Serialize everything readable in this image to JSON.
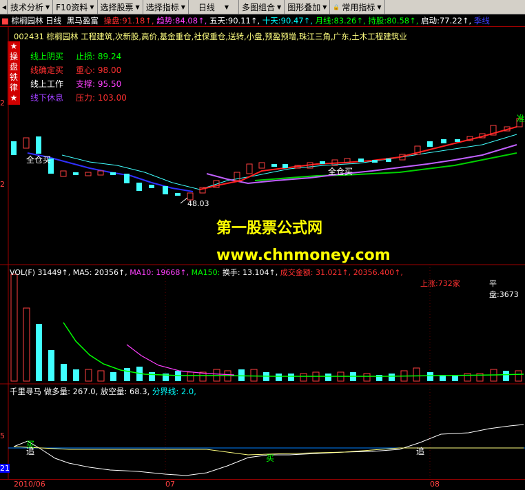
{
  "toolbar": {
    "items": [
      {
        "label": "技术分析"
      },
      {
        "label": "F10资料"
      },
      {
        "label": "选择股票"
      },
      {
        "label": "选择指标"
      },
      {
        "label": "日线"
      },
      {
        "label": "多图组合"
      },
      {
        "label": "图形叠加"
      },
      {
        "label": "常用指标"
      }
    ]
  },
  "header": {
    "title": "棕榈园林 日线",
    "sub": "黑马盈富",
    "stats": [
      {
        "label": "操盘:",
        "value": "91.18",
        "color": "#ff3030"
      },
      {
        "label": "趋势:",
        "value": "84.08",
        "color": "#ff40ff"
      },
      {
        "label": "五天:",
        "value": "90.11",
        "color": "#ffffff"
      },
      {
        "label": "十天:",
        "value": "90.47",
        "color": "#00ffff"
      },
      {
        "label": "月线:",
        "value": "83.26",
        "color": "#00ff00"
      },
      {
        "label": "持股:",
        "value": "80.58",
        "color": "#00ff00"
      },
      {
        "label": "启动:",
        "value": "77.22",
        "color": "#ffffff"
      },
      {
        "label": "季线",
        "value": "",
        "color": "#4040ff"
      }
    ],
    "info": "002431 棕榈园林 工程建筑,次新股,高价,基金重仓,社保重仓,送转,小盘,预盈预增,珠江三角,广东,土木工程建筑业"
  },
  "badge": {
    "chars": [
      "★",
      "操",
      "盘",
      "铁",
      "律",
      "★"
    ]
  },
  "legend": [
    {
      "name": "线上阴买",
      "label": "止损:",
      "value": "89.24",
      "color": "#00ff00"
    },
    {
      "name": "线确定买",
      "label": "重心:",
      "value": "98.00",
      "color": "#ff3030"
    },
    {
      "name": "线上工作",
      "label": "支撑:",
      "value": "95.50",
      "color": "#ffffff"
    },
    {
      "name": "线下休息",
      "label": "压力:",
      "value": "103.00",
      "color": "#a040ff"
    }
  ],
  "price_annotations": {
    "low_label": "48.03",
    "buy1": "全仓买",
    "buy2": "全仓买",
    "sell": "准"
  },
  "watermark": {
    "line1": "第一股票公式网",
    "line2": "www.chnmoney.com"
  },
  "vol": {
    "header": [
      {
        "text": "VOL(F) 31449",
        "color": "#ffffff"
      },
      {
        "text": "MA5: 20356",
        "color": "#ffffff"
      },
      {
        "text": "MA10: 19668",
        "color": "#ff40ff"
      },
      {
        "text": "MA150: ",
        "color": "#00ff00"
      },
      {
        "text": "换手: 13.104",
        "color": "#ffffff"
      },
      {
        "text": "成交金额: 31.021",
        "color": "#ff3030"
      },
      {
        "text": "20356.400",
        "color": "#ff3030"
      }
    ],
    "up_label": "上涨:732家",
    "flat_label": "平盘:3673"
  },
  "indicator": {
    "name": "千里寻马",
    "fields": [
      {
        "text": "做多量: 267.0",
        "color": "#ffffff"
      },
      {
        "text": "放空量: 68.3",
        "color": "#ffffff"
      },
      {
        "text": "分界线: 2.0,",
        "color": "#00ffff"
      }
    ],
    "signals": [
      "买",
      "追",
      "买",
      "追"
    ]
  },
  "dates": {
    "d1": "2010/06",
    "d2": "07",
    "d3": "08"
  },
  "axis": {
    "a": "21"
  }
}
